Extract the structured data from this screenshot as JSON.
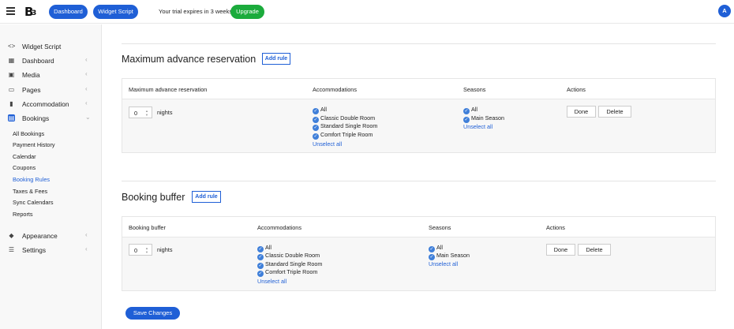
{
  "header": {
    "dashboard_label": "Dashboard",
    "widget_script_label": "Widget Script",
    "trial_text": "Your trial expires in 3 weeks",
    "upgrade_label": "Upgrade",
    "avatar_letter": "A",
    "logo_text": "B",
    "logo_superscript": "3"
  },
  "sidebar": {
    "items": [
      {
        "label": "Widget Script",
        "icon": "code-icon"
      },
      {
        "label": "Dashboard",
        "icon": "grid-icon"
      },
      {
        "label": "Media",
        "icon": "image-icon"
      },
      {
        "label": "Pages",
        "icon": "page-icon"
      },
      {
        "label": "Accommodation",
        "icon": "door-icon"
      },
      {
        "label": "Bookings",
        "icon": "calendar-icon"
      },
      {
        "label": "Appearance",
        "icon": "paint-icon"
      },
      {
        "label": "Settings",
        "icon": "sliders-icon"
      }
    ],
    "bookings_sub": [
      "All Bookings",
      "Payment History",
      "Calendar",
      "Coupons",
      "Booking Rules",
      "Taxes & Fees",
      "Sync Calendars",
      "Reports"
    ],
    "active_sub": "Booking Rules"
  },
  "sections": [
    {
      "title": "Maximum advance reservation",
      "add_rule": "Add rule",
      "columns": [
        "Maximum advance reservation",
        "Accommodations",
        "Seasons",
        "Actions"
      ],
      "row": {
        "value": "0",
        "unit": "nights",
        "accommodations": [
          "All",
          "Classic Double Room",
          "Standard Single Room",
          "Comfort Triple Room"
        ],
        "accommodations_link": "Unselect all",
        "seasons": [
          "All",
          "Main Season"
        ],
        "seasons_link": "Unselect all",
        "done": "Done",
        "delete": "Delete"
      }
    },
    {
      "title": "Booking buffer",
      "add_rule": "Add rule",
      "columns": [
        "Booking buffer",
        "Accommodations",
        "Seasons",
        "Actions"
      ],
      "row": {
        "value": "0",
        "unit": "nights",
        "accommodations": [
          "All",
          "Classic Double Room",
          "Standard Single Room",
          "Comfort Triple Room"
        ],
        "accommodations_link": "Unselect all",
        "seasons": [
          "All",
          "Main Season"
        ],
        "seasons_link": "Unselect all",
        "done": "Done",
        "delete": "Delete"
      }
    }
  ],
  "save_label": "Save Changes",
  "colors": {
    "accent": "#1f5fd6",
    "upgrade": "#1bab3c",
    "check": "#3f7fd9"
  }
}
